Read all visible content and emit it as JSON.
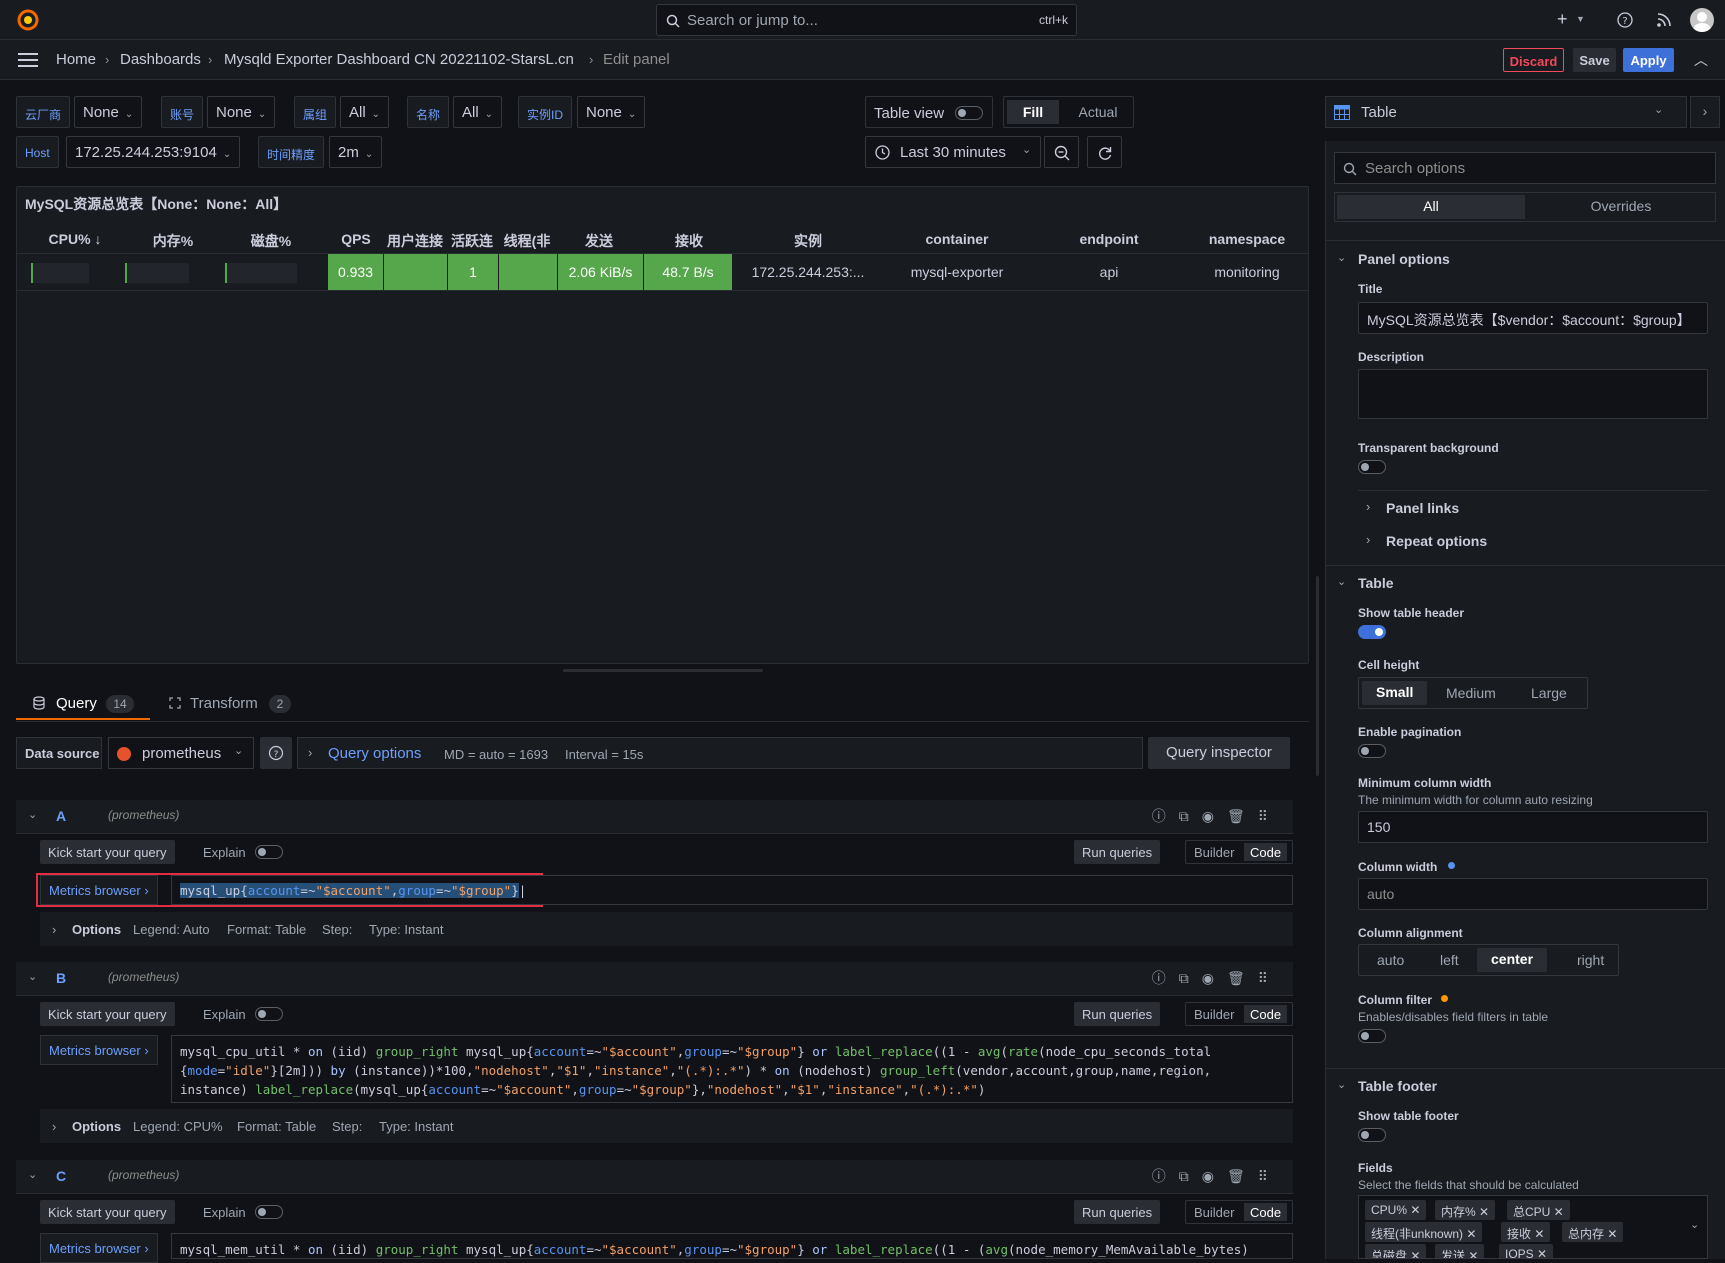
{
  "topbar": {
    "search_placeholder": "Search or jump to...",
    "search_shortcut": "ctrl+k",
    "plus_icon": "+"
  },
  "breadcrumbs": [
    "Home",
    "Dashboards",
    "Mysqld Exporter Dashboard CN 20221102-StarsL.cn",
    "Edit panel"
  ],
  "actions": {
    "discard": "Discard",
    "save": "Save",
    "apply": "Apply"
  },
  "variables": [
    {
      "label": "云厂商",
      "value": "None"
    },
    {
      "label": "账号",
      "value": "None"
    },
    {
      "label": "属组",
      "value": "All"
    },
    {
      "label": "名称",
      "value": "All"
    },
    {
      "label": "实例ID",
      "value": "None"
    },
    {
      "label": "Host",
      "value": "172.25.244.253:9104"
    },
    {
      "label": "时间精度",
      "value": "2m"
    }
  ],
  "view": {
    "table_view": "Table view",
    "fill": "Fill",
    "actual": "Actual",
    "time_range": "Last 30 minutes"
  },
  "panel": {
    "title": "MySQL资源总览表【None：None：All】",
    "columns": [
      "CPU% ↓",
      "内存%",
      "磁盘%",
      "QPS",
      "用户连接",
      "活跃连",
      "线程(非",
      "发送",
      "接收",
      "实例",
      "container",
      "endpoint",
      "namespace"
    ],
    "row": [
      "",
      "",
      "",
      "0.933",
      "",
      "1",
      "",
      "2.06 KiB/s",
      "48.7 B/s",
      "172.25.244.253:...",
      "mysql-exporter",
      "api",
      "monitoring"
    ]
  },
  "tabs": {
    "query": "Query",
    "query_count": "14",
    "transform": "Transform",
    "transform_count": "2"
  },
  "datasource": {
    "label": "Data source",
    "name": "prometheus",
    "query_options": "Query options",
    "md": "MD = auto = 1693",
    "interval": "Interval = 15s",
    "inspector": "Query inspector"
  },
  "common": {
    "kick_start": "Kick start your query",
    "explain": "Explain",
    "run": "Run queries",
    "builder": "Builder",
    "code": "Code",
    "metrics_browser": "Metrics browser ›",
    "options": "Options",
    "format": "Format: Table",
    "step": "Step:",
    "type": "Type: Instant",
    "ds_tag": "(prometheus)"
  },
  "queries": [
    {
      "letter": "A",
      "legend": "Legend: Auto"
    },
    {
      "letter": "B",
      "legend": "Legend: CPU%"
    },
    {
      "letter": "C",
      "legend": ""
    }
  ],
  "right": {
    "viz": "Table",
    "search_placeholder": "Search options",
    "all": "All",
    "overrides": "Overrides",
    "panel_options": "Panel options",
    "title_label": "Title",
    "title_value": "MySQL资源总览表【$vendor：$account：$group】",
    "description_label": "Description",
    "transparent": "Transparent background",
    "panel_links": "Panel links",
    "repeat_options": "Repeat options",
    "table_section": "Table",
    "show_header": "Show table header",
    "cell_height": "Cell height",
    "cell_opts": [
      "Small",
      "Medium",
      "Large"
    ],
    "pagination": "Enable pagination",
    "min_col_width": "Minimum column width",
    "min_col_desc": "The minimum width for column auto resizing",
    "min_col_value": "150",
    "col_width": "Column width",
    "col_width_value": "auto",
    "col_align": "Column alignment",
    "align_opts": [
      "auto",
      "left",
      "center",
      "right"
    ],
    "col_filter": "Column filter",
    "col_filter_desc": "Enables/disables field filters in table",
    "footer": "Table footer",
    "show_footer": "Show table footer",
    "fields": "Fields",
    "fields_desc": "Select the fields that should be calculated",
    "field_tags": [
      "CPU%",
      "内存%",
      "总CPU",
      "线程(非unknown)",
      "接收",
      "总内存",
      "总磁盘",
      "发送",
      "IOPS"
    ]
  },
  "colors": {
    "accent": "#3d71d9",
    "green": "#56a64b",
    "discard": "#f2495c",
    "highlight": "#e02f44"
  }
}
